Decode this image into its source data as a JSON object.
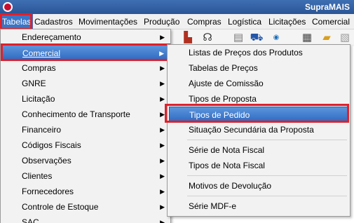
{
  "app": {
    "title": "SupraMAIS"
  },
  "menubar": {
    "items": [
      "Tabelas",
      "Cadastros",
      "Movimentações",
      "Produção",
      "Compras",
      "Logística",
      "Licitações",
      "Comercial"
    ]
  },
  "toolbar": {
    "icons": [
      "factory-icon",
      "headset-icon",
      "document-icon",
      "shopping-cart-icon",
      "nfe-icon",
      "calculator-icon",
      "folder-icon",
      "note-icon"
    ]
  },
  "tabelas_menu": {
    "items": [
      {
        "label": "Endereçamento",
        "submenu": true
      },
      {
        "label": "Comercial",
        "submenu": true
      },
      {
        "label": "Compras",
        "submenu": true
      },
      {
        "label": "GNRE",
        "submenu": true
      },
      {
        "label": "Licitação",
        "submenu": true
      },
      {
        "label": "Conhecimento de Transporte",
        "submenu": true
      },
      {
        "label": "Financeiro",
        "submenu": true
      },
      {
        "label": "Códigos Fiscais",
        "submenu": true
      },
      {
        "label": "Observações",
        "submenu": true
      },
      {
        "label": "Clientes",
        "submenu": true
      },
      {
        "label": "Fornecedores",
        "submenu": true
      },
      {
        "label": "Controle de Estoque",
        "submenu": true
      },
      {
        "label": "SAC",
        "submenu": true
      }
    ]
  },
  "comercial_submenu": {
    "items": [
      {
        "label": "Listas de Preços dos Produtos"
      },
      {
        "label": "Tabelas de Preços"
      },
      {
        "label": "Ajuste de Comissão"
      },
      {
        "label": "Tipos de Proposta"
      },
      {
        "label": "Tipos de Pedido"
      },
      {
        "label": "Situação Secundária da Proposta"
      },
      {
        "label": "Série de Nota Fiscal"
      },
      {
        "label": "Tipos de Nota Fiscal"
      },
      {
        "label": "Motivos de Devolução"
      },
      {
        "label": "Série MDF-e"
      }
    ]
  },
  "arrow_glyph": "▶"
}
